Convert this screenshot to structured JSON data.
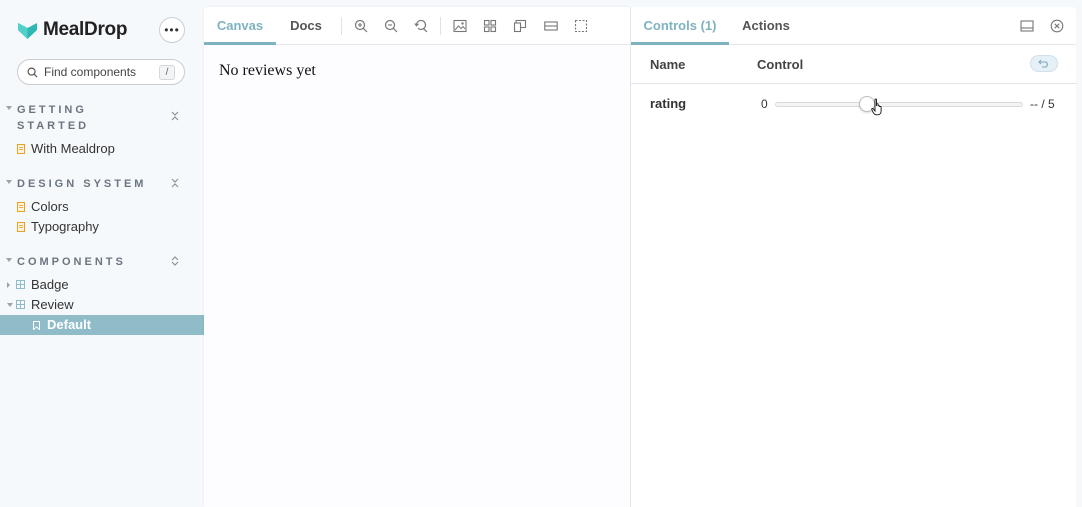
{
  "brand": {
    "name": "MealDrop",
    "accent": "#2fb8b3"
  },
  "sidebar": {
    "search_placeholder": "Find components",
    "search_shortcut": "/",
    "sections": [
      {
        "title": "GETTING STARTED",
        "items": [
          {
            "label": "With Mealdrop"
          }
        ]
      },
      {
        "title": "DESIGN SYSTEM",
        "items": [
          {
            "label": "Colors"
          },
          {
            "label": "Typography"
          }
        ]
      },
      {
        "title": "COMPONENTS",
        "items": [
          {
            "label": "Badge"
          },
          {
            "label": "Review"
          },
          {
            "label": "Default",
            "selected": true
          }
        ]
      }
    ]
  },
  "preview": {
    "tabs": [
      {
        "label": "Canvas",
        "active": true
      },
      {
        "label": "Docs"
      }
    ],
    "tools": [
      "zoom-in-icon",
      "zoom-out-icon",
      "zoom-reset-icon",
      "background-icon",
      "grid-icon",
      "viewport-icon",
      "measure-icon",
      "outline-icon"
    ],
    "canvas_text": "No reviews yet"
  },
  "addons": {
    "tabs": [
      {
        "label": "Controls (1)",
        "active": true
      },
      {
        "label": "Actions"
      }
    ],
    "table": {
      "col_name": "Name",
      "col_control": "Control",
      "rows": [
        {
          "name": "rating",
          "min": "0",
          "max_label": "-- / 5",
          "value_fraction": 0.37
        }
      ]
    }
  },
  "colors": {
    "accent": "#7fb2c0",
    "selected_bg": "#8fbcc8",
    "doc_icon": "#f0a020"
  }
}
